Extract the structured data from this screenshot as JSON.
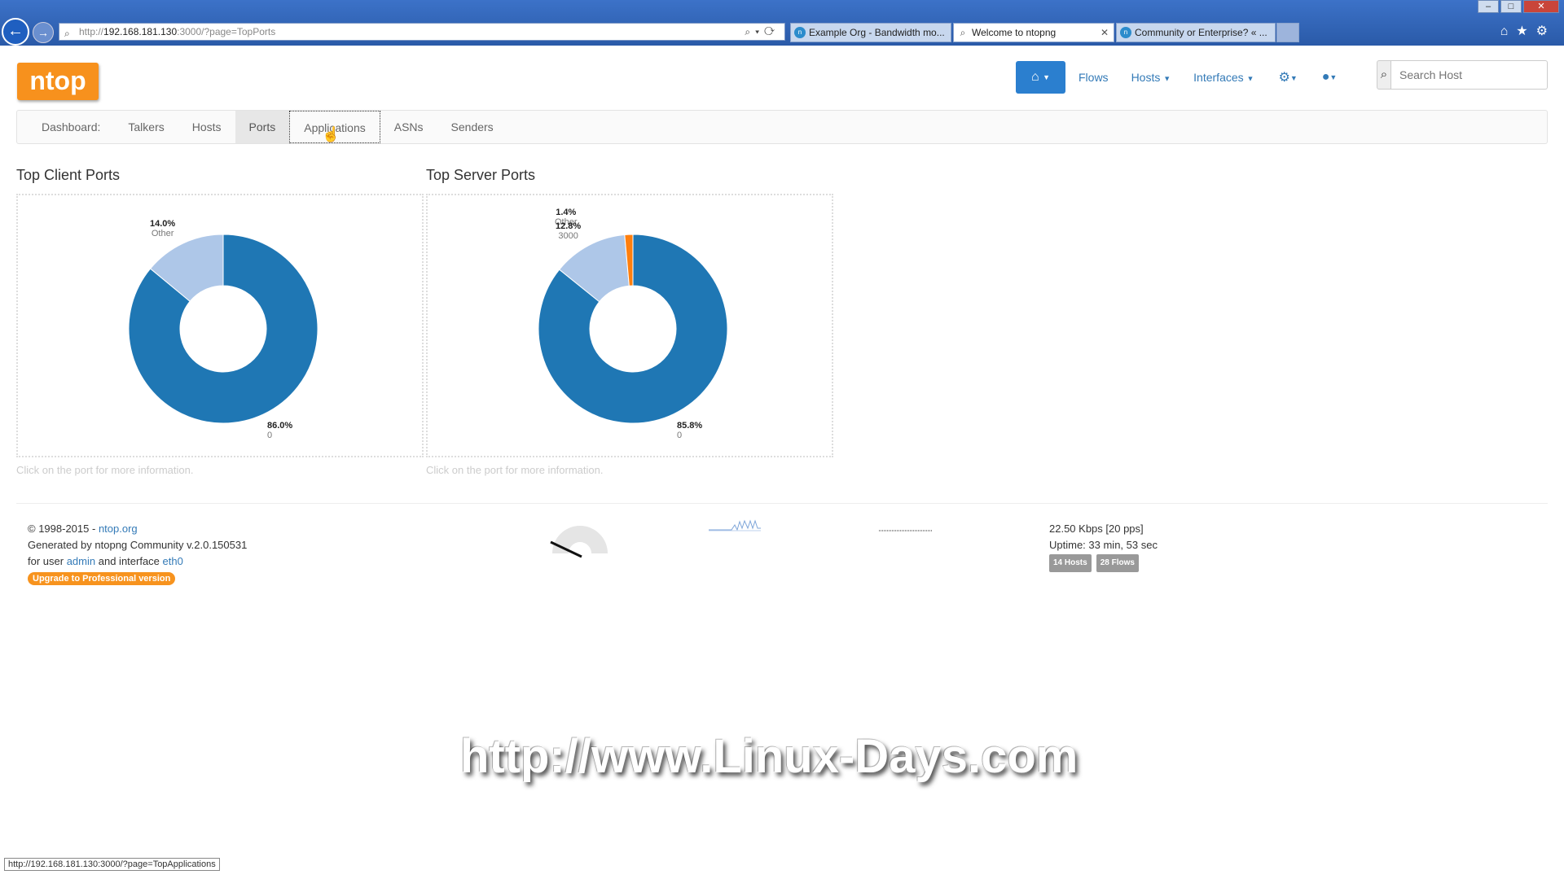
{
  "browser": {
    "url_prefix": "http://",
    "url_host": "192.168.181.130",
    "url_rest": ":3000/?page=TopPorts",
    "tabs": [
      {
        "label": "Example Org - Bandwidth mo..."
      },
      {
        "label": "Welcome to ntopng"
      },
      {
        "label": "Community or Enterprise? « ..."
      }
    ],
    "status_url": "http://192.168.181.130:3000/?page=TopApplications"
  },
  "logo": "ntop",
  "topnav": {
    "flows": "Flows",
    "hosts": "Hosts",
    "interfaces": "Interfaces",
    "search_placeholder": "Search Host"
  },
  "subnav": {
    "items": [
      "Dashboard:",
      "Talkers",
      "Hosts",
      "Ports",
      "Applications",
      "ASNs",
      "Senders"
    ],
    "active": "Ports",
    "focused": "Applications"
  },
  "charts": {
    "client": {
      "title": "Top Client Ports",
      "help": "Click on the port for more information.",
      "labels": [
        {
          "pct": "86.0%",
          "name": "0"
        },
        {
          "pct": "14.0%",
          "name": "Other"
        }
      ]
    },
    "server": {
      "title": "Top Server Ports",
      "help": "Click on the port for more information.",
      "labels": [
        {
          "pct": "85.8%",
          "name": "0"
        },
        {
          "pct": "12.8%",
          "name": "3000"
        },
        {
          "pct": "1.4%",
          "name": "Other"
        }
      ]
    }
  },
  "chart_data": [
    {
      "type": "pie",
      "title": "Top Client Ports",
      "categories": [
        "0",
        "Other"
      ],
      "values": [
        86.0,
        14.0
      ],
      "colors": [
        "#1f77b4",
        "#aec7e8"
      ]
    },
    {
      "type": "pie",
      "title": "Top Server Ports",
      "categories": [
        "0",
        "3000",
        "Other"
      ],
      "values": [
        85.8,
        12.8,
        1.4
      ],
      "colors": [
        "#1f77b4",
        "#aec7e8",
        "#ff7f0e"
      ]
    }
  ],
  "footer": {
    "copyright": "© 1998-2015 -",
    "site": "ntop.org",
    "generated": "Generated by ntopng Community v.2.0.150531",
    "for_user": "for user",
    "user": "admin",
    "and_interface": "and interface",
    "interface": "eth0",
    "upgrade": "Upgrade to Professional version",
    "throughput": "22.50 Kbps [20 pps]",
    "uptime": "Uptime: 33 min, 53 sec",
    "hosts_badge": "14 Hosts",
    "flows_badge": "28 Flows"
  },
  "watermark": "http://www.Linux-Days.com"
}
